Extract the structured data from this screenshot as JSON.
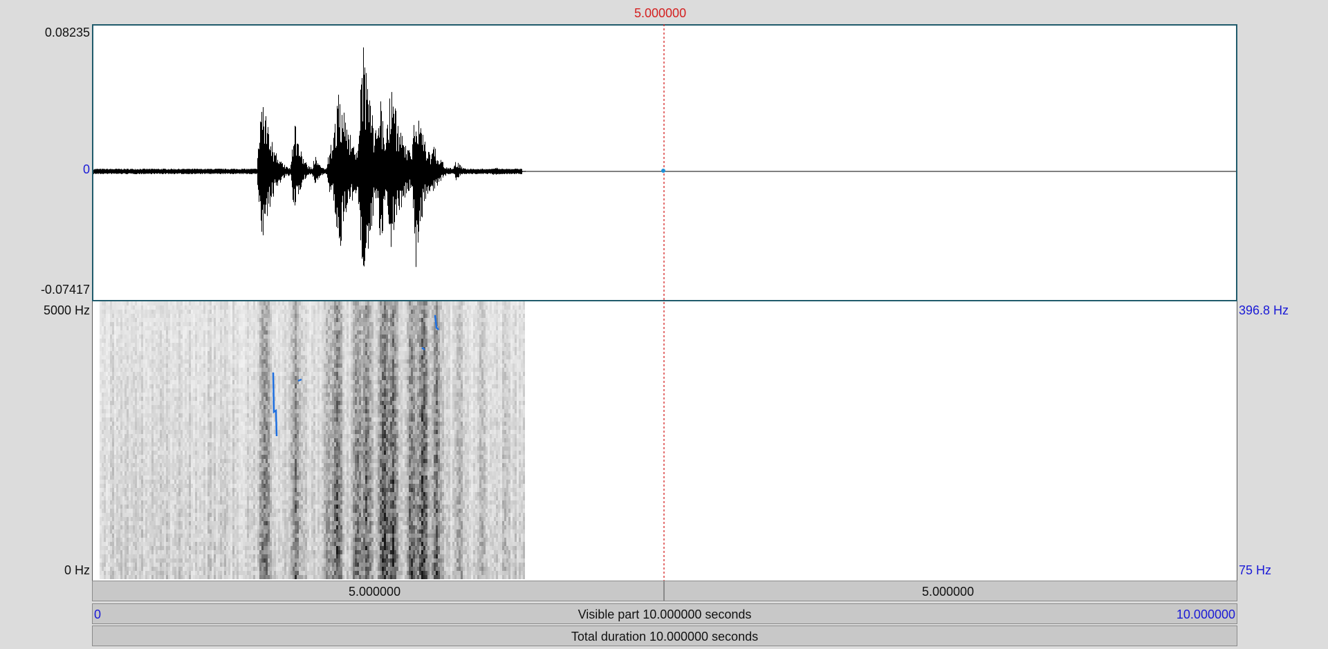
{
  "cursor": {
    "time_label": "5.000000",
    "color": "#d42020"
  },
  "waveform": {
    "max_label": "0.08235",
    "zero_label": "0",
    "min_label": "-0.07417"
  },
  "spectrogram": {
    "freq_top_label": "5000 Hz",
    "freq_bottom_label": "0 Hz",
    "pitch_top_label": "396.8 Hz",
    "pitch_bottom_label": "75 Hz",
    "pitch_color": "#1e6fe0"
  },
  "bars": {
    "left_segment_label": "5.000000",
    "right_segment_label": "5.000000",
    "visible_start": "0",
    "visible_label": "Visible part 10.000000 seconds",
    "visible_end": "10.000000",
    "total_label": "Total duration 10.000000 seconds"
  }
}
